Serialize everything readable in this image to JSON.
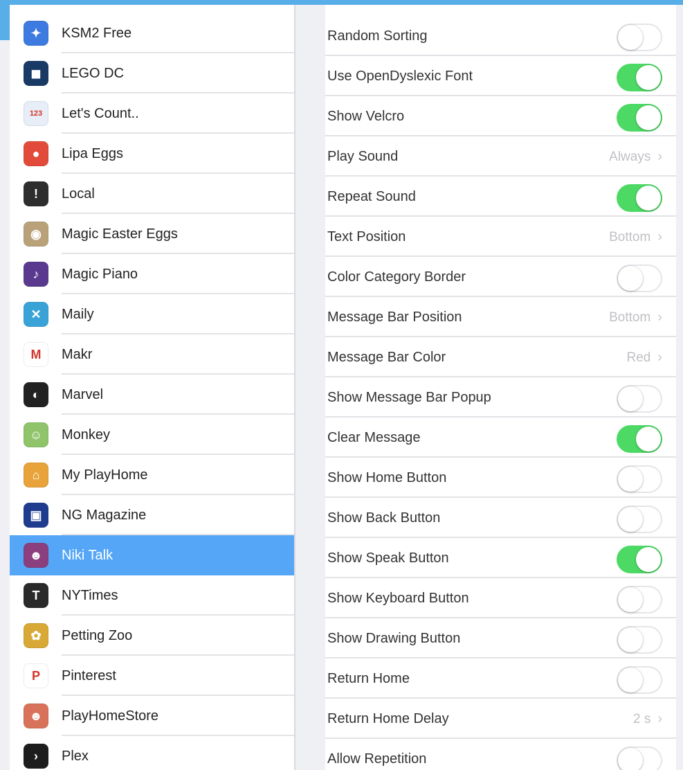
{
  "sidebar": {
    "apps": [
      {
        "label": "KSM2 Free",
        "icon": "ksm2-icon",
        "color": "#3d7be0",
        "glyph": "✦"
      },
      {
        "label": "LEGO DC",
        "icon": "lego-dc-icon",
        "color": "#1a3a66",
        "glyph": "◼"
      },
      {
        "label": "Let's Count..",
        "icon": "lets-count-icon",
        "color": "#e7eef7",
        "glyph": "123"
      },
      {
        "label": "Lipa Eggs",
        "icon": "lipa-eggs-icon",
        "color": "#e24b3a",
        "glyph": "●"
      },
      {
        "label": "Local",
        "icon": "local-icon",
        "color": "#2e2e2e",
        "glyph": "!"
      },
      {
        "label": "Magic Easter Eggs",
        "icon": "magic-easter-eggs-icon",
        "color": "#b9a27a",
        "glyph": "◉"
      },
      {
        "label": "Magic Piano",
        "icon": "magic-piano-icon",
        "color": "#5a3a8f",
        "glyph": "♪"
      },
      {
        "label": "Maily",
        "icon": "maily-icon",
        "color": "#39a3d8",
        "glyph": "✕"
      },
      {
        "label": "Makr",
        "icon": "makr-icon",
        "color": "#ffffff",
        "glyph": "M"
      },
      {
        "label": "Marvel",
        "icon": "marvel-icon",
        "color": "#222222",
        "glyph": "◐"
      },
      {
        "label": "Monkey",
        "icon": "monkey-icon",
        "color": "#8fc46a",
        "glyph": "☺"
      },
      {
        "label": "My PlayHome",
        "icon": "my-playhome-icon",
        "color": "#e8a33b",
        "glyph": "⌂"
      },
      {
        "label": "NG Magazine",
        "icon": "ng-magazine-icon",
        "color": "#1f3c8f",
        "glyph": "▣"
      },
      {
        "label": "Niki Talk",
        "icon": "niki-talk-icon",
        "color": "#8b3f7f",
        "glyph": "☻"
      },
      {
        "label": "NYTimes",
        "icon": "nytimes-icon",
        "color": "#2a2a2a",
        "glyph": "T"
      },
      {
        "label": "Petting Zoo",
        "icon": "petting-zoo-icon",
        "color": "#d8a937",
        "glyph": "✿"
      },
      {
        "label": "Pinterest",
        "icon": "pinterest-icon",
        "color": "#ffffff",
        "glyph": "P"
      },
      {
        "label": "PlayHomeStore",
        "icon": "playhomestore-icon",
        "color": "#d9725a",
        "glyph": "☻"
      },
      {
        "label": "Plex",
        "icon": "plex-icon",
        "color": "#1d1d1d",
        "glyph": "›"
      }
    ],
    "selected": "Niki Talk",
    "selected_color": "#55a6f7"
  },
  "settings": {
    "items": [
      {
        "label": "Random Sorting",
        "kind": "toggle",
        "on": false
      },
      {
        "label": "Use OpenDyslexic Font",
        "kind": "toggle",
        "on": true
      },
      {
        "label": "Show Velcro",
        "kind": "toggle",
        "on": true
      },
      {
        "label": "Play Sound",
        "kind": "value",
        "value": "Always"
      },
      {
        "label": "Repeat Sound",
        "kind": "toggle",
        "on": true
      },
      {
        "label": "Text Position",
        "kind": "value",
        "value": "Bottom"
      },
      {
        "label": "Color Category Border",
        "kind": "toggle",
        "on": false
      },
      {
        "label": "Message Bar Position",
        "kind": "value",
        "value": "Bottom"
      },
      {
        "label": "Message Bar Color",
        "kind": "value",
        "value": "Red"
      },
      {
        "label": "Show Message Bar Popup",
        "kind": "toggle",
        "on": false
      },
      {
        "label": "Clear Message",
        "kind": "toggle",
        "on": true
      },
      {
        "label": "Show Home Button",
        "kind": "toggle",
        "on": false
      },
      {
        "label": "Show Back Button",
        "kind": "toggle",
        "on": false
      },
      {
        "label": "Show Speak Button",
        "kind": "toggle",
        "on": true
      },
      {
        "label": "Show Keyboard Button",
        "kind": "toggle",
        "on": false
      },
      {
        "label": "Show Drawing Button",
        "kind": "toggle",
        "on": false
      },
      {
        "label": "Return Home",
        "kind": "toggle",
        "on": false
      },
      {
        "label": "Return Home Delay",
        "kind": "value",
        "value": "2 s"
      },
      {
        "label": "Allow Repetition",
        "kind": "toggle",
        "on": false
      }
    ],
    "toggle_on_color": "#4cd964"
  }
}
